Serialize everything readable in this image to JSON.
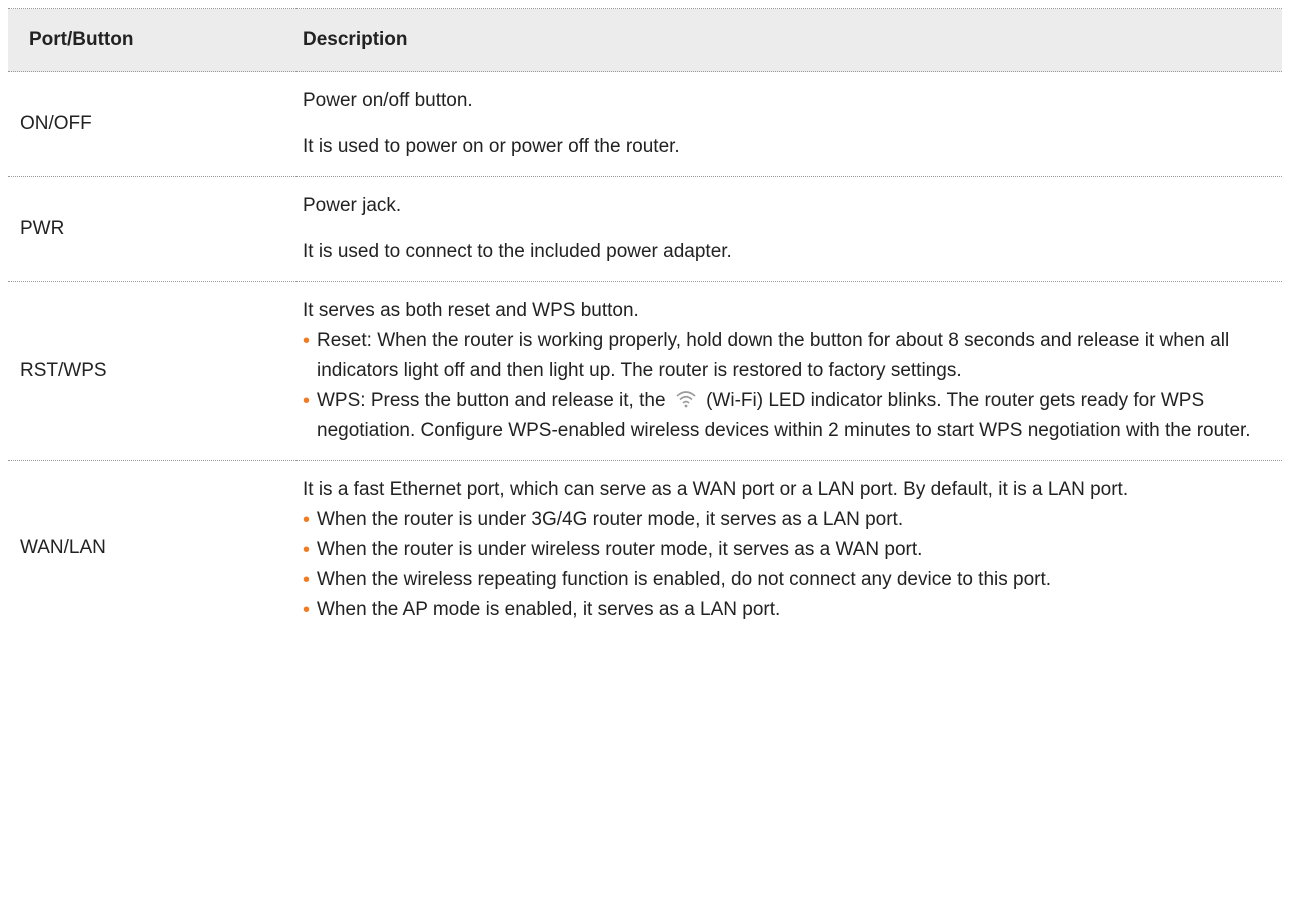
{
  "table": {
    "header": {
      "col1": "Port/Button",
      "col2": "Description"
    },
    "rows": [
      {
        "port": "ON/OFF",
        "paragraphs": [
          "Power on/off button.",
          "It is used to power on or power off the router."
        ]
      },
      {
        "port": "PWR",
        "paragraphs": [
          "Power jack.",
          "It is used to connect to the included power adapter."
        ]
      },
      {
        "port": "RST/WPS",
        "intro": "It serves as both reset and WPS button.",
        "bullets": [
          "Reset: When the router is working properly, hold down the button for about 8 seconds and release it when all indicators light off and then light up. The router is restored to factory settings.",
          {
            "before_icon": "WPS: Press the button and release it, the",
            "icon": "wifi-icon",
            "after_icon": "(Wi-Fi) LED indicator blinks. The router gets ready for WPS negotiation. Configure WPS-enabled wireless devices within 2 minutes to start WPS negotiation with the router."
          }
        ]
      },
      {
        "port": "WAN/LAN",
        "intro": "It is a fast Ethernet port, which can serve as a WAN port or a LAN port. By default, it is a LAN port.",
        "bullets": [
          "When the router is under 3G/4G router mode, it serves as a LAN port.",
          "When the router is under wireless router mode, it serves as a WAN port.",
          "When the wireless repeating function is enabled, do not connect any device to this port.",
          "When the AP mode is enabled, it serves as a LAN port."
        ]
      }
    ]
  },
  "colors": {
    "header_bg": "#ececec",
    "bullet": "#f47a20",
    "text": "#222222",
    "rule": "#9a9a9a"
  }
}
